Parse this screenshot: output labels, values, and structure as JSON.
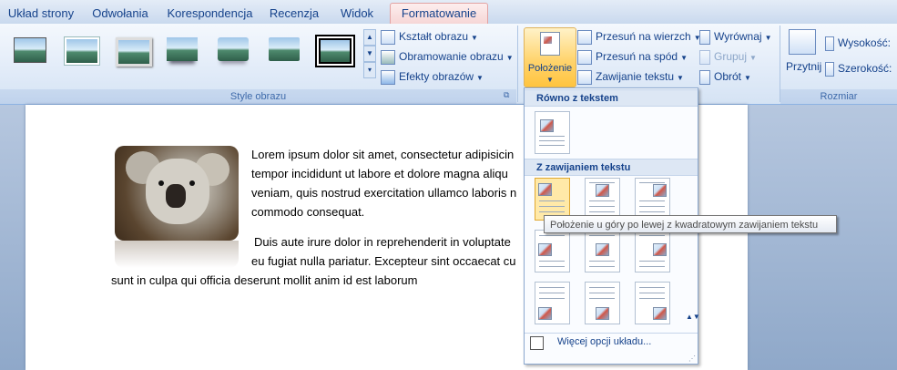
{
  "tabs": [
    "Układ strony",
    "Odwołania",
    "Korespondencja",
    "Recenzja",
    "Widok",
    "Formatowanie"
  ],
  "ribbon": {
    "picture_styles_label": "Style obrazu",
    "shape_label": "Kształt obrazu",
    "border_label": "Obramowanie obrazu",
    "effects_label": "Efekty obrazów",
    "position_label": "Położenie",
    "bring_front_label": "Przesuń na wierzch",
    "send_back_label": "Przesuń na spód",
    "wrap_label": "Zawijanie tekstu",
    "align_label": "Wyrównaj",
    "group_label": "Grupuj",
    "rotate_label": "Obrót",
    "crop_label": "Przytnij",
    "height_label": "Wysokość:",
    "width_label": "Szerokość:",
    "size_group_label": "Rozmiar"
  },
  "document": {
    "lines": [
      "Lorem ipsum dolor sit amet, consectetur adipisicin",
      "tempor incididunt ut labore et dolore magna aliqu",
      "veniam, quis nostrud exercitation ullamco laboris n",
      "commodo consequat.",
      "Duis aute irure dolor in reprehenderit in voluptate",
      "eu fugiat nulla pariatur. Excepteur sint occaecat cu",
      "sunt in culpa qui officia deserunt mollit anim id est laborum"
    ]
  },
  "dropdown": {
    "inline_header": "Równo z tekstem",
    "wrap_header": "Z zawijaniem tekstu",
    "more_options": "Więcej opcji układu..."
  },
  "tooltip": "Położenie u góry po lewej z kwadratowym zawijaniem tekstu",
  "colors": {
    "ribbon_bg": "#dfe9f7",
    "accent": "#ffd46e",
    "text": "#15428b"
  }
}
